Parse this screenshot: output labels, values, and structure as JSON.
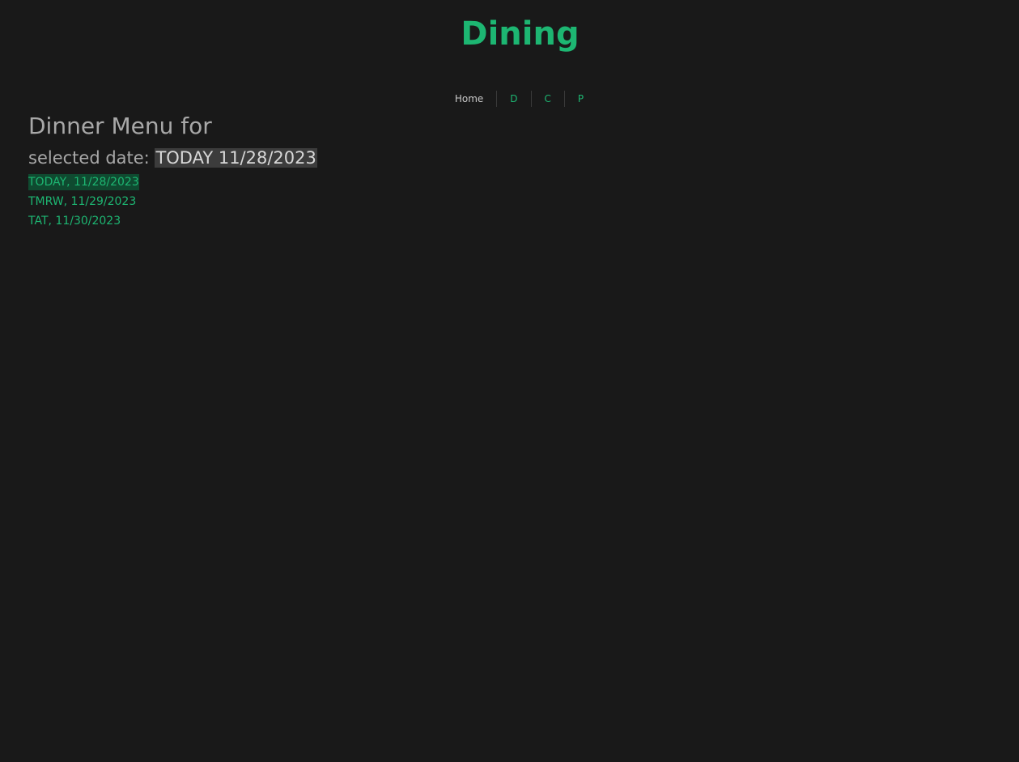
{
  "header": {
    "title": "Dining"
  },
  "nav": {
    "items": [
      {
        "label": "Home"
      },
      {
        "label": "D"
      },
      {
        "label": "C"
      },
      {
        "label": "P"
      }
    ]
  },
  "main": {
    "heading": "Dinner Menu for",
    "selected_label": "selected date: ",
    "selected_value": "TODAY 11/28/2023",
    "dates": [
      {
        "label": "TODAY, 11/28/2023",
        "active": true
      },
      {
        "label": "TMRW, 11/29/2023",
        "active": false
      },
      {
        "label": "TAT, 11/30/2023",
        "active": false
      }
    ]
  },
  "colors": {
    "background": "#191919",
    "accent": "#1db672",
    "text_muted": "#a8a8a8",
    "text_light": "#d8d8d8",
    "nav_home": "#c8c8c8",
    "highlight_bg": "#3c3c3c",
    "active_bg": "#0f4a30"
  }
}
